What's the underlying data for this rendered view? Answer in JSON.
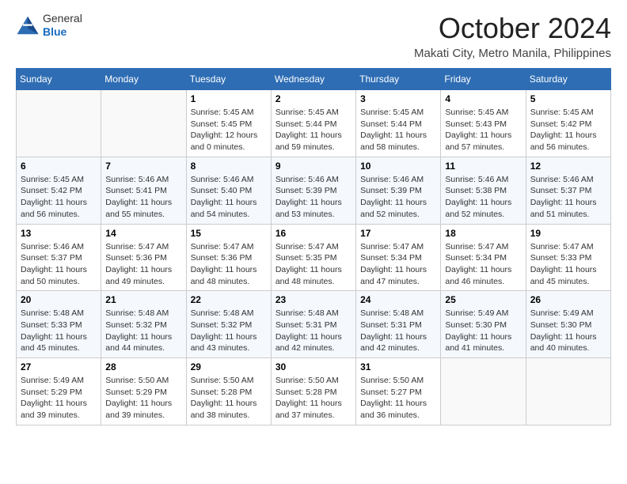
{
  "header": {
    "logo_general": "General",
    "logo_blue": "Blue",
    "month_title": "October 2024",
    "location": "Makati City, Metro Manila, Philippines"
  },
  "weekdays": [
    "Sunday",
    "Monday",
    "Tuesday",
    "Wednesday",
    "Thursday",
    "Friday",
    "Saturday"
  ],
  "weeks": [
    [
      {
        "day": "",
        "sunrise": "",
        "sunset": "",
        "daylight": ""
      },
      {
        "day": "",
        "sunrise": "",
        "sunset": "",
        "daylight": ""
      },
      {
        "day": "1",
        "sunrise": "Sunrise: 5:45 AM",
        "sunset": "Sunset: 5:45 PM",
        "daylight": "Daylight: 12 hours and 0 minutes."
      },
      {
        "day": "2",
        "sunrise": "Sunrise: 5:45 AM",
        "sunset": "Sunset: 5:44 PM",
        "daylight": "Daylight: 11 hours and 59 minutes."
      },
      {
        "day": "3",
        "sunrise": "Sunrise: 5:45 AM",
        "sunset": "Sunset: 5:44 PM",
        "daylight": "Daylight: 11 hours and 58 minutes."
      },
      {
        "day": "4",
        "sunrise": "Sunrise: 5:45 AM",
        "sunset": "Sunset: 5:43 PM",
        "daylight": "Daylight: 11 hours and 57 minutes."
      },
      {
        "day": "5",
        "sunrise": "Sunrise: 5:45 AM",
        "sunset": "Sunset: 5:42 PM",
        "daylight": "Daylight: 11 hours and 56 minutes."
      }
    ],
    [
      {
        "day": "6",
        "sunrise": "Sunrise: 5:45 AM",
        "sunset": "Sunset: 5:42 PM",
        "daylight": "Daylight: 11 hours and 56 minutes."
      },
      {
        "day": "7",
        "sunrise": "Sunrise: 5:46 AM",
        "sunset": "Sunset: 5:41 PM",
        "daylight": "Daylight: 11 hours and 55 minutes."
      },
      {
        "day": "8",
        "sunrise": "Sunrise: 5:46 AM",
        "sunset": "Sunset: 5:40 PM",
        "daylight": "Daylight: 11 hours and 54 minutes."
      },
      {
        "day": "9",
        "sunrise": "Sunrise: 5:46 AM",
        "sunset": "Sunset: 5:39 PM",
        "daylight": "Daylight: 11 hours and 53 minutes."
      },
      {
        "day": "10",
        "sunrise": "Sunrise: 5:46 AM",
        "sunset": "Sunset: 5:39 PM",
        "daylight": "Daylight: 11 hours and 52 minutes."
      },
      {
        "day": "11",
        "sunrise": "Sunrise: 5:46 AM",
        "sunset": "Sunset: 5:38 PM",
        "daylight": "Daylight: 11 hours and 52 minutes."
      },
      {
        "day": "12",
        "sunrise": "Sunrise: 5:46 AM",
        "sunset": "Sunset: 5:37 PM",
        "daylight": "Daylight: 11 hours and 51 minutes."
      }
    ],
    [
      {
        "day": "13",
        "sunrise": "Sunrise: 5:46 AM",
        "sunset": "Sunset: 5:37 PM",
        "daylight": "Daylight: 11 hours and 50 minutes."
      },
      {
        "day": "14",
        "sunrise": "Sunrise: 5:47 AM",
        "sunset": "Sunset: 5:36 PM",
        "daylight": "Daylight: 11 hours and 49 minutes."
      },
      {
        "day": "15",
        "sunrise": "Sunrise: 5:47 AM",
        "sunset": "Sunset: 5:36 PM",
        "daylight": "Daylight: 11 hours and 48 minutes."
      },
      {
        "day": "16",
        "sunrise": "Sunrise: 5:47 AM",
        "sunset": "Sunset: 5:35 PM",
        "daylight": "Daylight: 11 hours and 48 minutes."
      },
      {
        "day": "17",
        "sunrise": "Sunrise: 5:47 AM",
        "sunset": "Sunset: 5:34 PM",
        "daylight": "Daylight: 11 hours and 47 minutes."
      },
      {
        "day": "18",
        "sunrise": "Sunrise: 5:47 AM",
        "sunset": "Sunset: 5:34 PM",
        "daylight": "Daylight: 11 hours and 46 minutes."
      },
      {
        "day": "19",
        "sunrise": "Sunrise: 5:47 AM",
        "sunset": "Sunset: 5:33 PM",
        "daylight": "Daylight: 11 hours and 45 minutes."
      }
    ],
    [
      {
        "day": "20",
        "sunrise": "Sunrise: 5:48 AM",
        "sunset": "Sunset: 5:33 PM",
        "daylight": "Daylight: 11 hours and 45 minutes."
      },
      {
        "day": "21",
        "sunrise": "Sunrise: 5:48 AM",
        "sunset": "Sunset: 5:32 PM",
        "daylight": "Daylight: 11 hours and 44 minutes."
      },
      {
        "day": "22",
        "sunrise": "Sunrise: 5:48 AM",
        "sunset": "Sunset: 5:32 PM",
        "daylight": "Daylight: 11 hours and 43 minutes."
      },
      {
        "day": "23",
        "sunrise": "Sunrise: 5:48 AM",
        "sunset": "Sunset: 5:31 PM",
        "daylight": "Daylight: 11 hours and 42 minutes."
      },
      {
        "day": "24",
        "sunrise": "Sunrise: 5:48 AM",
        "sunset": "Sunset: 5:31 PM",
        "daylight": "Daylight: 11 hours and 42 minutes."
      },
      {
        "day": "25",
        "sunrise": "Sunrise: 5:49 AM",
        "sunset": "Sunset: 5:30 PM",
        "daylight": "Daylight: 11 hours and 41 minutes."
      },
      {
        "day": "26",
        "sunrise": "Sunrise: 5:49 AM",
        "sunset": "Sunset: 5:30 PM",
        "daylight": "Daylight: 11 hours and 40 minutes."
      }
    ],
    [
      {
        "day": "27",
        "sunrise": "Sunrise: 5:49 AM",
        "sunset": "Sunset: 5:29 PM",
        "daylight": "Daylight: 11 hours and 39 minutes."
      },
      {
        "day": "28",
        "sunrise": "Sunrise: 5:50 AM",
        "sunset": "Sunset: 5:29 PM",
        "daylight": "Daylight: 11 hours and 39 minutes."
      },
      {
        "day": "29",
        "sunrise": "Sunrise: 5:50 AM",
        "sunset": "Sunset: 5:28 PM",
        "daylight": "Daylight: 11 hours and 38 minutes."
      },
      {
        "day": "30",
        "sunrise": "Sunrise: 5:50 AM",
        "sunset": "Sunset: 5:28 PM",
        "daylight": "Daylight: 11 hours and 37 minutes."
      },
      {
        "day": "31",
        "sunrise": "Sunrise: 5:50 AM",
        "sunset": "Sunset: 5:27 PM",
        "daylight": "Daylight: 11 hours and 36 minutes."
      },
      {
        "day": "",
        "sunrise": "",
        "sunset": "",
        "daylight": ""
      },
      {
        "day": "",
        "sunrise": "",
        "sunset": "",
        "daylight": ""
      }
    ]
  ]
}
